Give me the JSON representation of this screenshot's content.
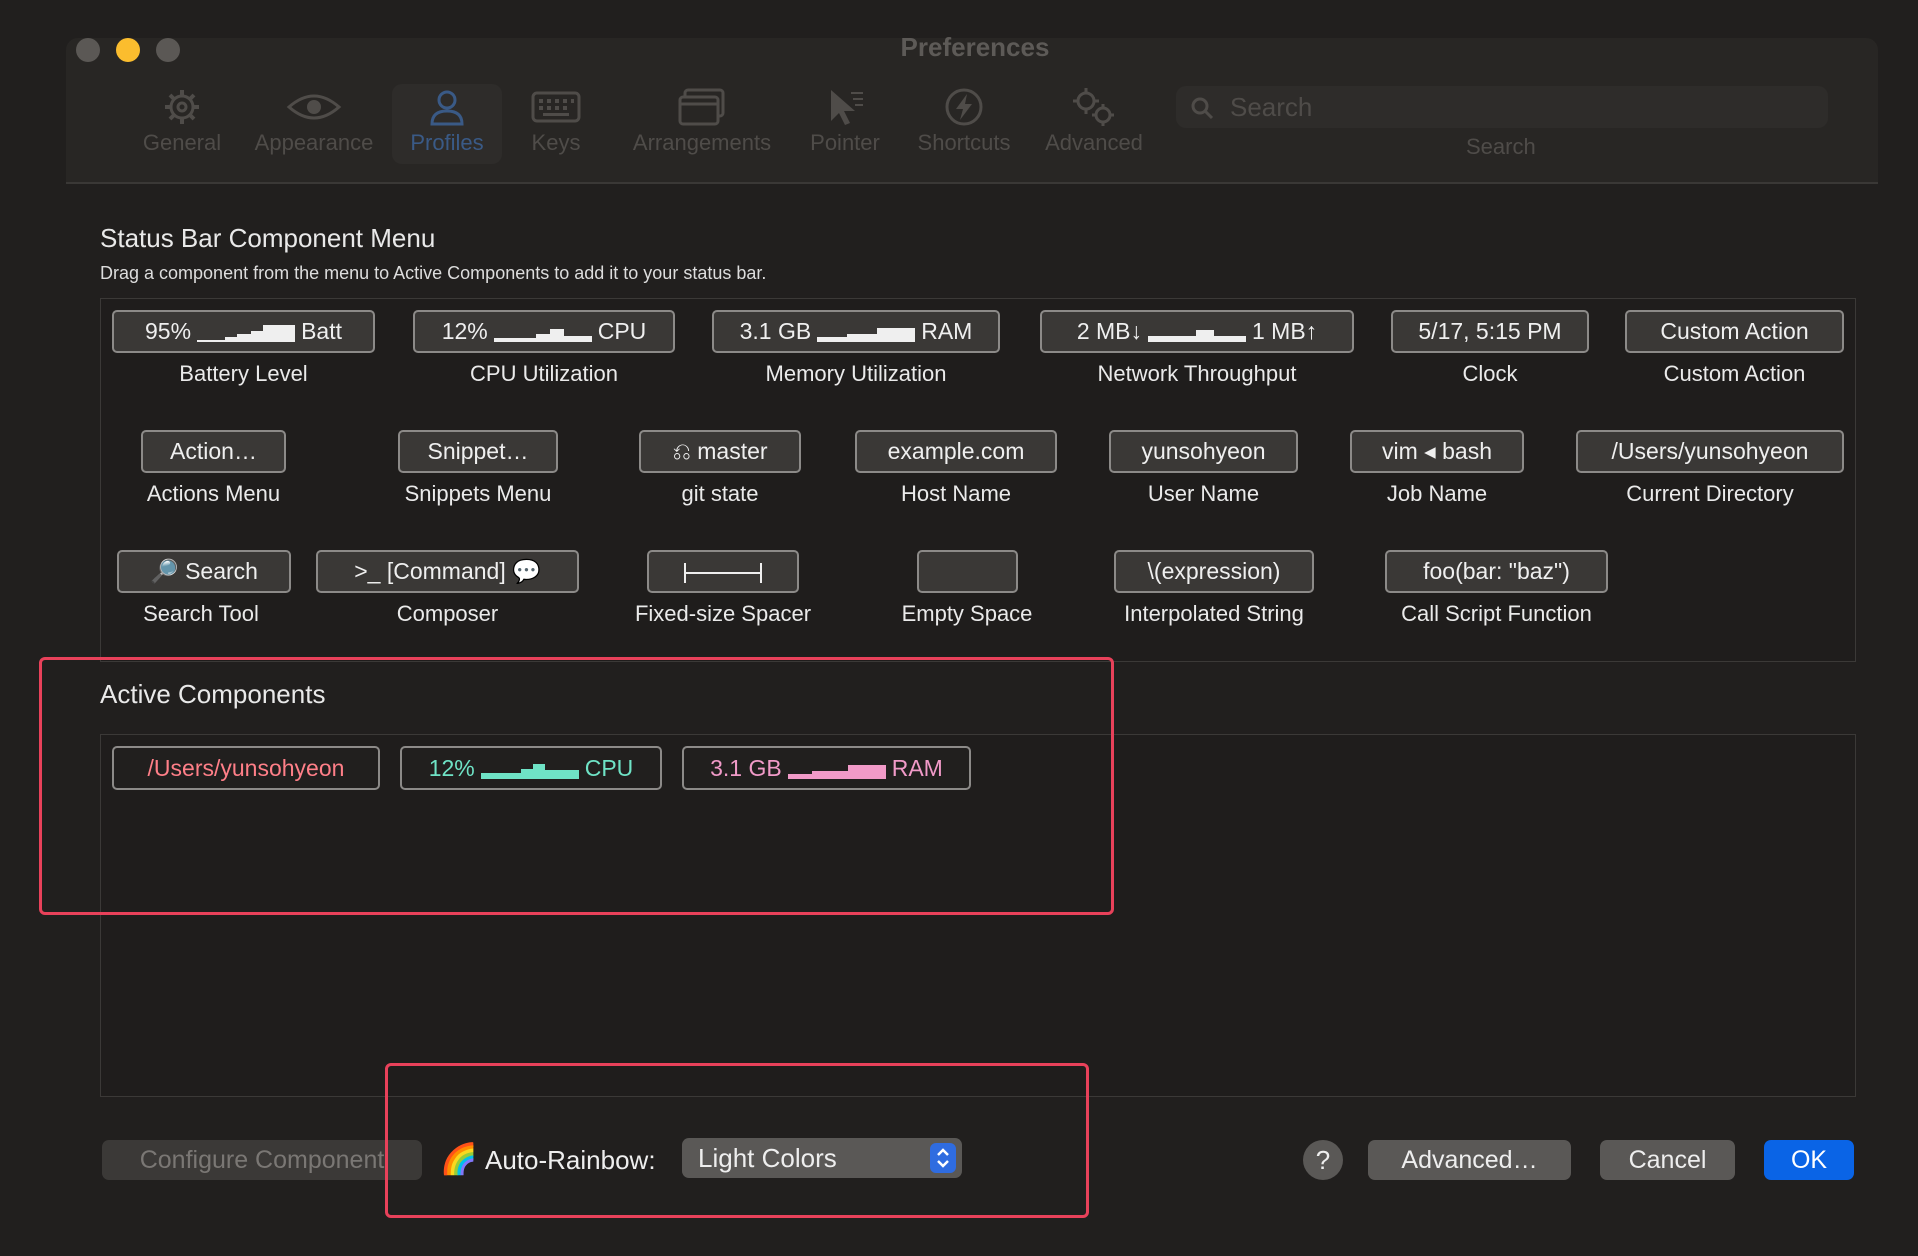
{
  "window": {
    "title": "Preferences"
  },
  "toolbar": {
    "items": [
      {
        "label": "General",
        "icon": "gear-icon"
      },
      {
        "label": "Appearance",
        "icon": "eye-icon"
      },
      {
        "label": "Profiles",
        "icon": "person-icon",
        "selected": true
      },
      {
        "label": "Keys",
        "icon": "keyboard-icon"
      },
      {
        "label": "Arrangements",
        "icon": "window-stack-icon"
      },
      {
        "label": "Pointer",
        "icon": "pointer-icon"
      },
      {
        "label": "Shortcuts",
        "icon": "bolt-icon"
      },
      {
        "label": "Advanced",
        "icon": "gears-icon"
      }
    ],
    "search_placeholder": "Search",
    "search_label": "Search"
  },
  "component_menu": {
    "title": "Status Bar Component Menu",
    "subtitle": "Drag a component from the menu to Active Components to add it to your status bar.",
    "components": [
      {
        "chip_left": "95%",
        "chip_right": "Batt",
        "sparkline": true,
        "label": "Battery Level"
      },
      {
        "chip_left": "12%",
        "chip_right": "CPU",
        "sparkline": true,
        "label": "CPU Utilization"
      },
      {
        "chip_left": "3.1 GB",
        "chip_right": "RAM",
        "sparkline": true,
        "label": "Memory Utilization"
      },
      {
        "chip_left": "2 MB↓",
        "chip_right": "1 MB↑",
        "sparkline": true,
        "label": "Network Throughput"
      },
      {
        "chip": "5/17, 5:15 PM",
        "label": "Clock"
      },
      {
        "chip": "Custom Action",
        "label": "Custom Action"
      },
      {
        "chip": "Action…",
        "label": "Actions Menu"
      },
      {
        "chip": "Snippet…",
        "label": "Snippets Menu"
      },
      {
        "chip": "⎌ master",
        "label": "git state"
      },
      {
        "chip": "example.com",
        "label": "Host Name"
      },
      {
        "chip": "yunsohyeon",
        "label": "User Name"
      },
      {
        "chip": "vim ◂ bash",
        "label": "Job Name"
      },
      {
        "chip": "/Users/yunsohyeon",
        "label": "Current Directory"
      },
      {
        "chip": "🔎 Search",
        "label": "Search Tool"
      },
      {
        "chip": ">_ [Command] 💬",
        "label": "Composer"
      },
      {
        "chip": "├────┤",
        "label": "Fixed-size Spacer"
      },
      {
        "chip": "",
        "label": "Empty Space"
      },
      {
        "chip": "\\(expression)",
        "label": "Interpolated String"
      },
      {
        "chip": "foo(bar: \"baz\")",
        "label": "Call Script Function"
      }
    ]
  },
  "active_components": {
    "title": "Active Components",
    "items": [
      {
        "text": "/Users/yunsohyeon",
        "color": "#ff7f88"
      },
      {
        "text_left": "12%",
        "text_right": "CPU",
        "color": "#6fe3c6",
        "sparkline": true
      },
      {
        "text_left": "3.1 GB",
        "text_right": "RAM",
        "color": "#f19ac8",
        "sparkline": true
      }
    ]
  },
  "footer": {
    "configure_label": "Configure Component",
    "rainbow_icon": "🌈",
    "auto_rainbow_label": "Auto-Rainbow:",
    "auto_rainbow_value": "Light Colors",
    "help_label": "?",
    "advanced_label": "Advanced…",
    "cancel_label": "Cancel",
    "ok_label": "OK"
  },
  "colors": {
    "accent": "#0a64e6",
    "highlight_box": "#e8415a"
  }
}
